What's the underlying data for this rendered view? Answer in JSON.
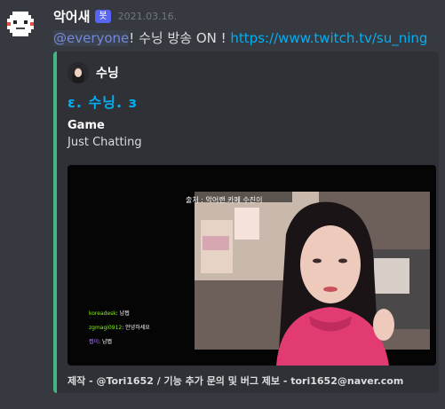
{
  "message": {
    "username": "악어새",
    "badge": "봇",
    "timestamp": "2021.03.16.",
    "mention": "@everyone",
    "text_middle": "! 수닝 방송 ON ! ",
    "link": "https://www.twitch.tv/su_ning"
  },
  "embed": {
    "accent_color": "#43b581",
    "author_name": "수닝",
    "title": "ε. 수닝. з",
    "field_name": "Game",
    "field_value": "Just Chatting",
    "footer": "제작 - @Tori1652 / 기능 추가 문의 및 버그 제보 - tori1652@naver.com",
    "stream_image": {
      "overlay_text": "출처 : 악어랜 카페 수진이",
      "chat": [
        {
          "name": "koreadesk",
          "text": ": 냠쩝"
        },
        {
          "name": "zgmagi0912",
          "text": ": 안녕하세요"
        },
        {
          "name": "쩝이",
          "text": ": 냠쩝"
        }
      ]
    }
  },
  "colors": {
    "background": "#36393f",
    "embed_background": "#2f3136",
    "link": "#00b0f4",
    "mention": "#7289da",
    "bot_badge": "#5865f2"
  }
}
